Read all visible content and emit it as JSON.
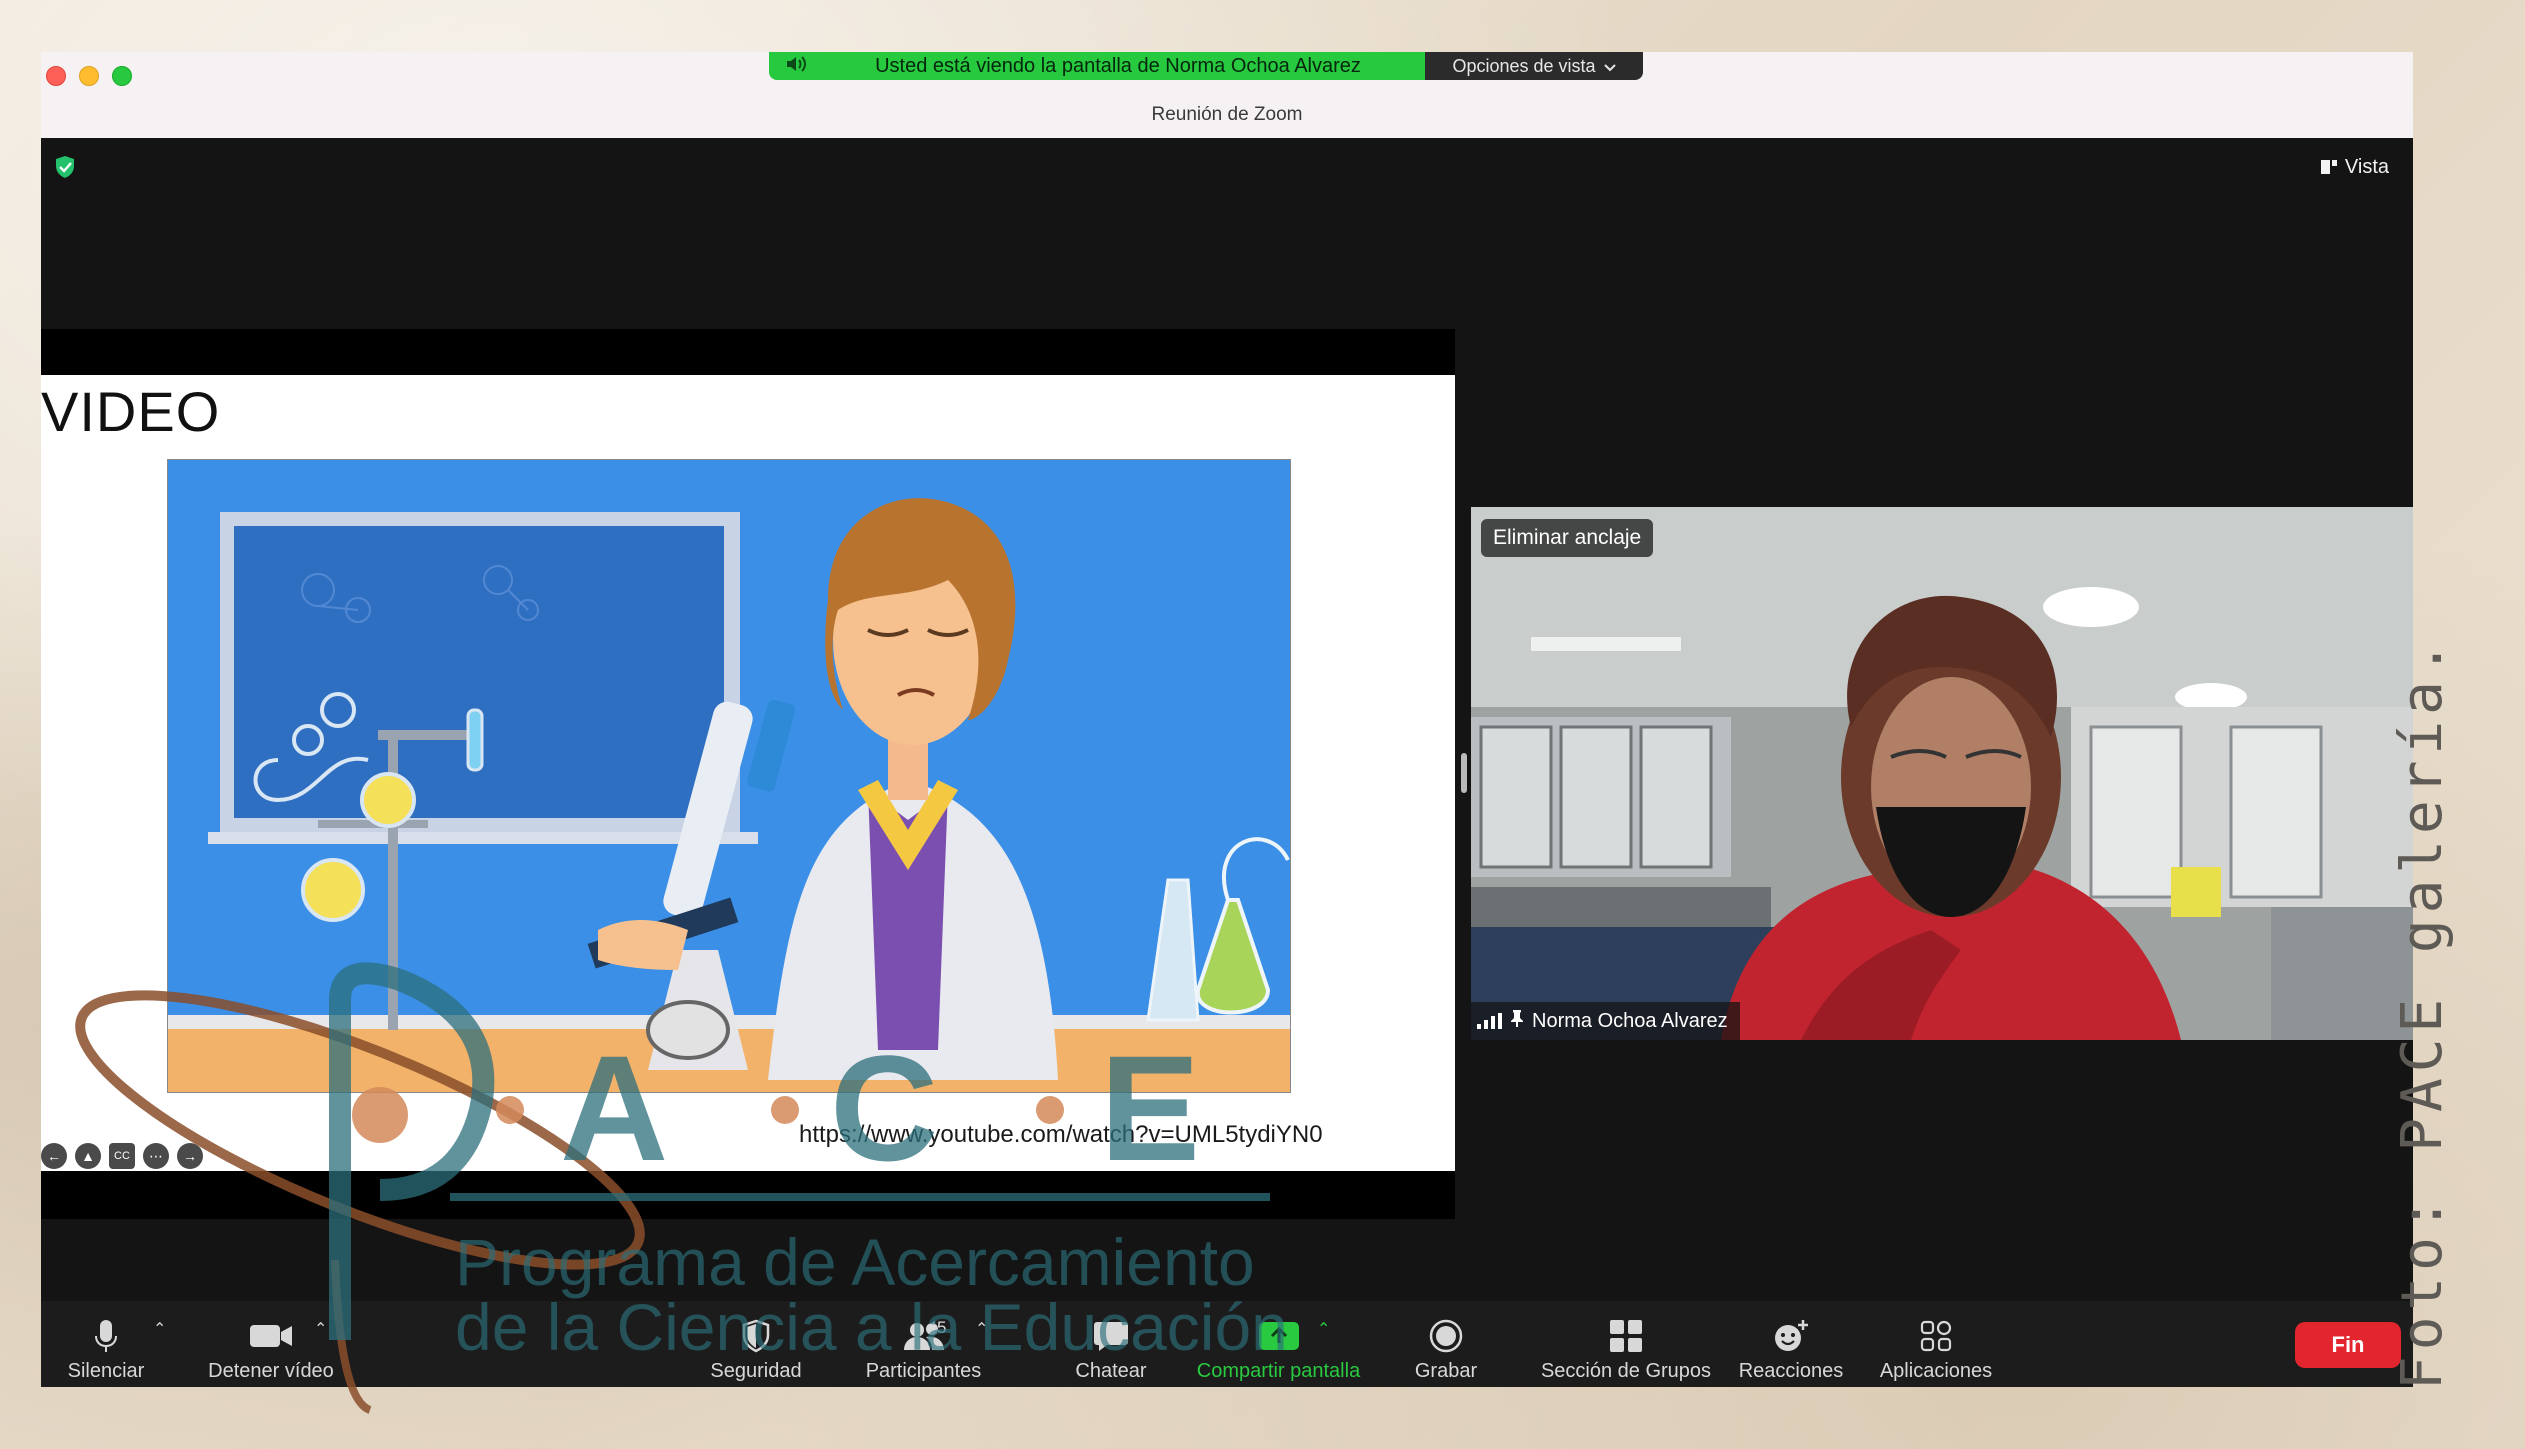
{
  "window": {
    "title": "Reunión de Zoom",
    "share_banner": "Usted está viendo la pantalla de Norma Ochoa Alvarez",
    "view_options": "Opciones de vista",
    "vista_label": "Vista"
  },
  "slide": {
    "title": "VIDEO",
    "url": "https://www.youtube.com/watch?v=UML5tydiYN0"
  },
  "participant": {
    "unpin_label": "Eliminar anclaje",
    "name": "Norma Ochoa Alvarez"
  },
  "toolbar": {
    "mute": "Silenciar",
    "stop_video": "Detener vídeo",
    "security": "Seguridad",
    "participants": "Participantes",
    "participants_count": "45",
    "chat": "Chatear",
    "share_screen": "Compartir pantalla",
    "record": "Grabar",
    "breakout": "Sección de Grupos",
    "reactions": "Reacciones",
    "apps": "Aplicaciones",
    "end": "Fin"
  },
  "watermark": {
    "letters": [
      "P",
      "A",
      "C",
      "E"
    ],
    "line1": "Programa de Acercamiento",
    "line2": "de la Ciencia a la Educación"
  },
  "credit": "Foto: PACE galería.",
  "colors": {
    "share_green": "#27c93f",
    "end_red": "#e3262d",
    "toolbar_bg": "#1c1c1c",
    "watermark_teal": "#2c6f7c",
    "watermark_brown": "#8a4d2a"
  }
}
